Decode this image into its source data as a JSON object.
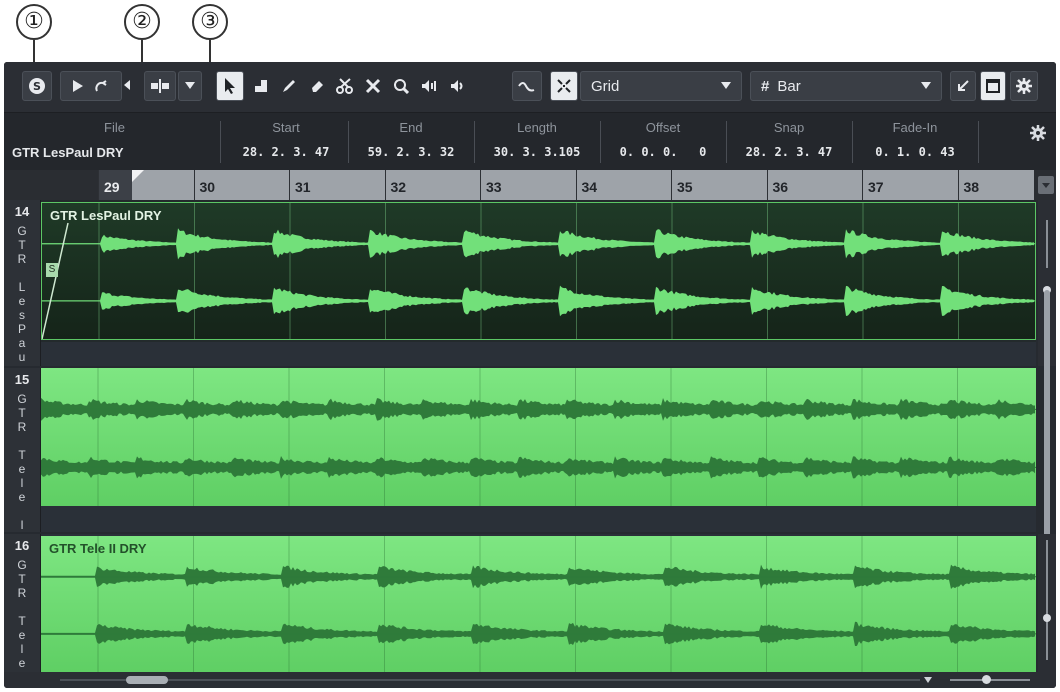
{
  "callouts": [
    "①",
    "②",
    "③"
  ],
  "toolbar": {
    "grid_label": "Grid",
    "bar_label": "Bar",
    "hash_symbol": "#",
    "colors": {
      "bg": "#2b2e34",
      "button": "#3a3e45",
      "active": "#e9ecef"
    }
  },
  "info_line": {
    "file_header": "File",
    "file_value": "GTR LesPaul DRY",
    "columns": [
      {
        "header": "Start",
        "value": "28. 2. 3. 47"
      },
      {
        "header": "End",
        "value": "59. 2. 3. 32"
      },
      {
        "header": "Length",
        "value": "30. 3. 3.105"
      },
      {
        "header": "Offset",
        "value": "0. 0. 0.   0"
      },
      {
        "header": "Snap",
        "value": "28. 2. 3. 47"
      },
      {
        "header": "Fade-In",
        "value": "0. 1. 0. 43"
      }
    ]
  },
  "ruler": {
    "bars": [
      "29",
      "30",
      "31",
      "32",
      "33",
      "34",
      "35",
      "36",
      "37",
      "38"
    ]
  },
  "tracks": [
    {
      "number": "14",
      "name_letters": "G\nT\nR\n\nL\ne\ns\nP\na\nu",
      "event_name": "GTR LesPaul DRY",
      "solo_label": "S"
    },
    {
      "number": "15",
      "name_letters": "G\nT\nR\n\nT\ne\nl\ne\n\nI",
      "event_name": ""
    },
    {
      "number": "16",
      "name_letters": "G\nT\nR\n\nT\ne\nl\ne",
      "event_name": "GTR Tele II DRY"
    }
  ],
  "colors": {
    "selected_event": "#1d3324",
    "event_green": "#6fd873",
    "wave_dark": "#2f7b3a",
    "wave_light": "#72e07a"
  }
}
